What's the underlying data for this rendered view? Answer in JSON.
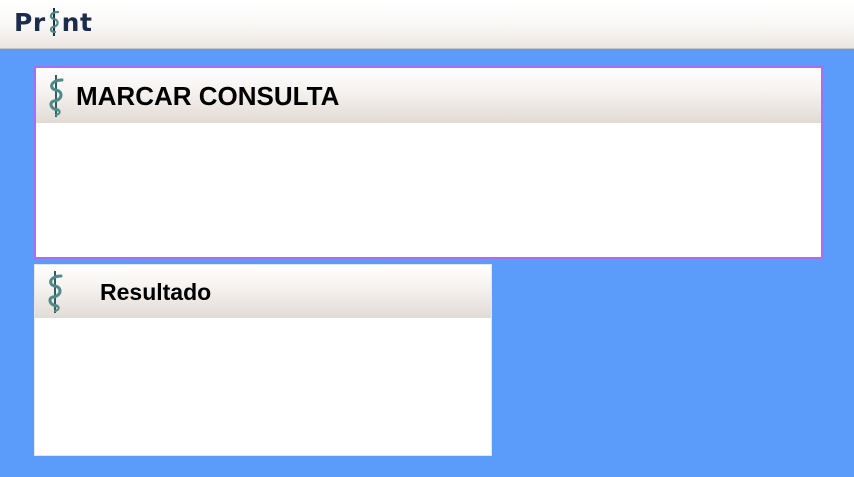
{
  "app": {
    "logo_left": "Pr",
    "logo_right": "nt",
    "logo_icon": "caduceus-staff-icon"
  },
  "panels": {
    "consulta": {
      "title": "MARCAR CONSULTA",
      "icon": "caduceus-staff-icon"
    },
    "resultado": {
      "title": "Resultado",
      "icon": "caduceus-staff-icon"
    }
  },
  "colors": {
    "background": "#5b9cfa",
    "panel_border_active": "#a86ff0",
    "logo_text": "#1b2c4c",
    "icon_teal": "#4f8a86"
  }
}
